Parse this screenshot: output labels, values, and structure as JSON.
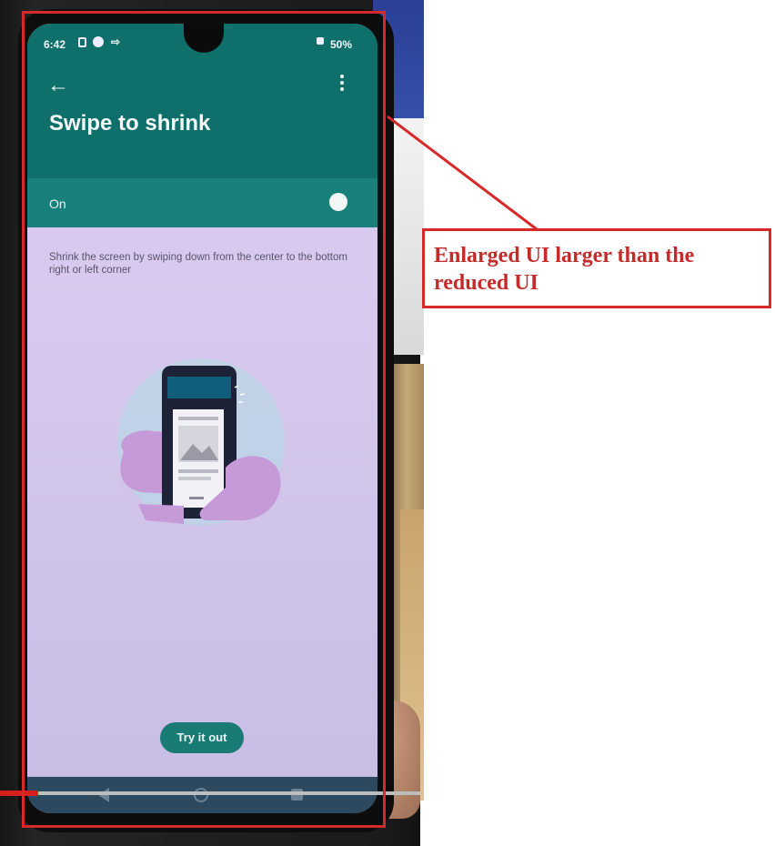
{
  "status_bar": {
    "time": "6:42",
    "battery": "50%"
  },
  "app_bar": {
    "title": "Swipe to shrink"
  },
  "toggle": {
    "label": "On",
    "state": "on"
  },
  "description": "Shrink the screen by swiping down from the center to the bottom right or left corner",
  "action_button": {
    "label": "Try it out"
  },
  "annotation": {
    "text": "Enlarged UI larger than the reduced UI",
    "color": "#d62a2a"
  },
  "colors": {
    "teal": "#0f6f6b",
    "teal_light": "#19807b",
    "lavender": "#d6c8ec"
  },
  "icons": {
    "back": "arrow-left-icon",
    "more": "more-vertical-icon",
    "nav_back": "triangle-back-icon",
    "nav_home": "circle-home-icon",
    "nav_recents": "square-recents-icon"
  }
}
